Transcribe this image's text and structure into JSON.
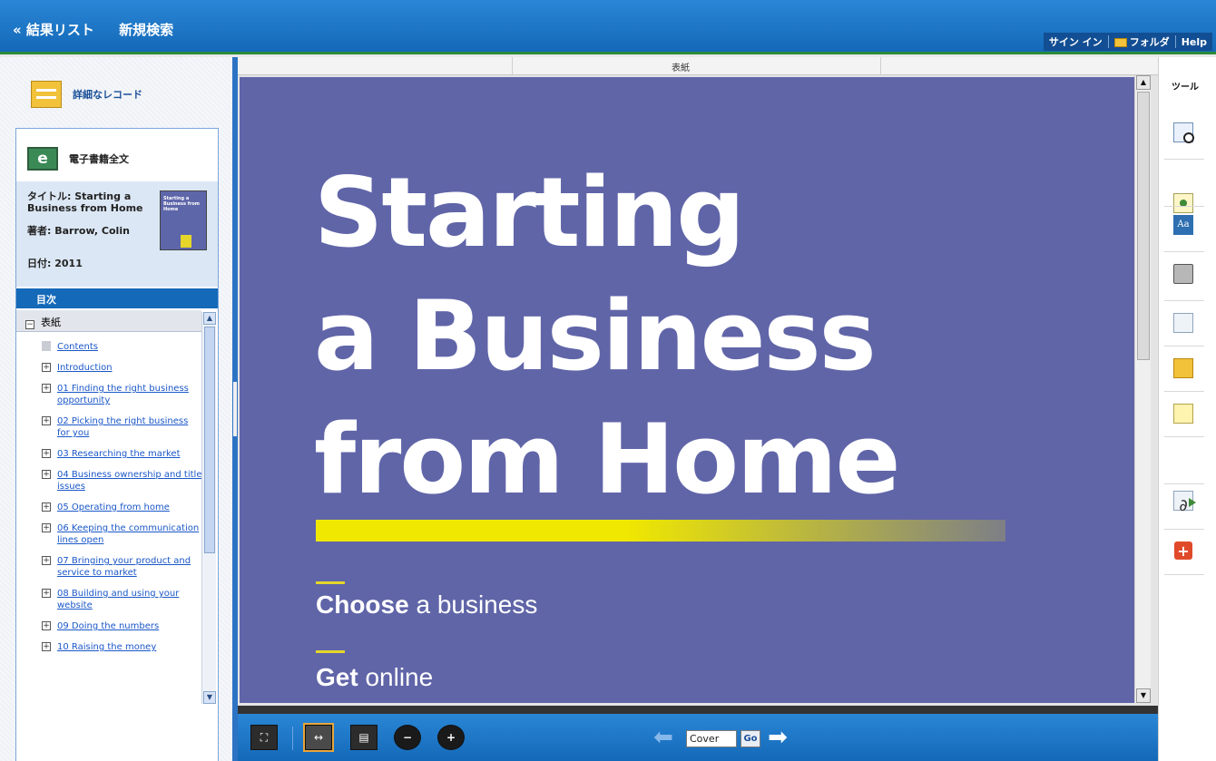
{
  "header": {
    "results_link": "« 結果リスト",
    "new_search": "新規検索",
    "sign_in": "サイン イン",
    "folder": "フォルダ",
    "help": "Help"
  },
  "sidebar": {
    "detail_record": "詳細なレコード",
    "ebook_full_text": "電子書籍全文",
    "title_label": "タイトル:",
    "title_value": "Starting a Business from Home",
    "author_label": "著者:",
    "author_value": "Barrow, Colin",
    "date_label": "日付:",
    "date_value": "2011",
    "thumbnail_text": "Starting a Business from Home",
    "toc_header": "目次",
    "toc_root": "表紙",
    "toc_items": [
      "Contents",
      "Introduction",
      "01 Finding the right business opportunity",
      "02 Picking the right business for you",
      "03 Researching the market",
      "04 Business ownership and title issues",
      "05 Operating from home",
      "06 Keeping the communication lines open",
      "07 Bringing your product and service to market",
      "08 Building and using your website",
      "09 Doing the numbers",
      "10 Raising the money"
    ]
  },
  "viewer": {
    "page_label": "表紙",
    "cover": {
      "line1": "Starting",
      "line2": "a Business",
      "line3": "from Home",
      "sub1_bold": "Choose",
      "sub1_rest": " a business",
      "sub2_bold": "Get",
      "sub2_rest": " online"
    },
    "page_input_value": "Cover",
    "go_label": "Go"
  },
  "tools": {
    "title": "ツール",
    "icons": [
      "find-in-book-icon",
      "image-icon",
      "font-size-icon",
      "print-icon",
      "email-icon",
      "folder-icon",
      "notes-icon",
      "export-icon",
      "permalink-icon",
      "add-icon"
    ]
  },
  "colors": {
    "brand_blue": "#1469b8",
    "cover_bg": "#6065a8",
    "highlight_yellow": "#f0e800"
  }
}
